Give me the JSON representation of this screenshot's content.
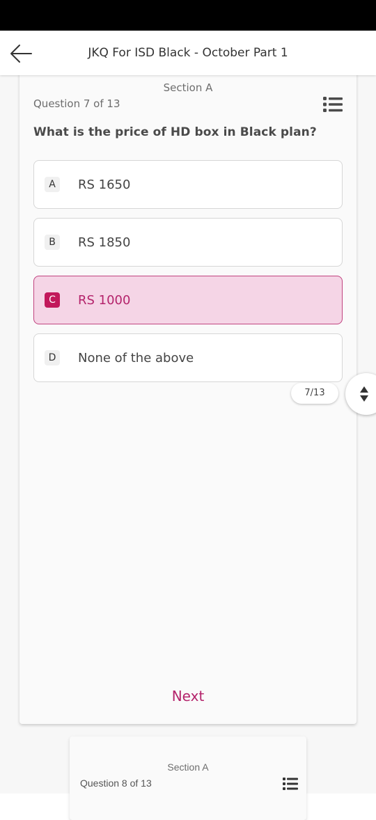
{
  "header": {
    "title": "JKQ For ISD Black - October Part 1",
    "back_icon": "arrow-left-icon"
  },
  "question_card": {
    "section": "Section A",
    "counter": "Question 7 of 13",
    "list_icon": "list-icon",
    "question": "What is the price of HD box in Black plan?",
    "options": [
      {
        "letter": "A",
        "text": "RS 1650",
        "selected": false
      },
      {
        "letter": "B",
        "text": "RS 1850",
        "selected": false
      },
      {
        "letter": "C",
        "text": "RS 1000",
        "selected": true
      },
      {
        "letter": "D",
        "text": "None of the above",
        "selected": false
      }
    ],
    "progress": "7/13",
    "next_label": "Next"
  },
  "nav_toggle_icon": "up-down-arrows-icon",
  "next_card": {
    "section": "Section A",
    "counter": "Question 8 of 13",
    "list_icon": "list-icon"
  },
  "colors": {
    "accent": "#b4236b",
    "selected_background": "#f5d5e6",
    "selected_badge": "#c2185b"
  }
}
